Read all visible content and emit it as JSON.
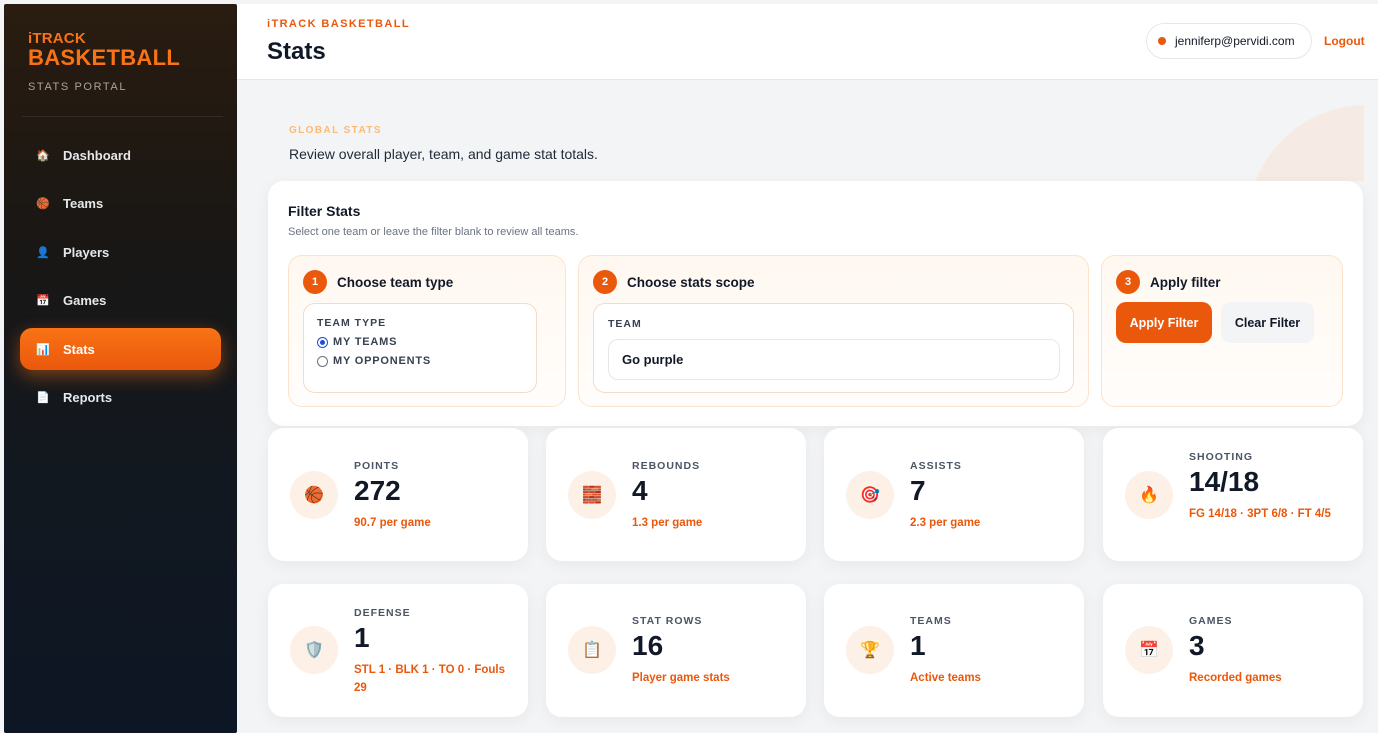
{
  "brand": {
    "top": "iTRACK",
    "main": "BASKETBALL",
    "sub": "STATS PORTAL"
  },
  "sidebar": {
    "items": [
      {
        "label": "Dashboard",
        "icon": "house-icon",
        "glyph": "🏠",
        "active": false
      },
      {
        "label": "Teams",
        "icon": "basketball-icon",
        "glyph": "🏀",
        "active": false
      },
      {
        "label": "Players",
        "icon": "person-icon",
        "glyph": "👤",
        "active": false
      },
      {
        "label": "Games",
        "icon": "calendar-icon",
        "glyph": "📅",
        "active": false
      },
      {
        "label": "Stats",
        "icon": "bar-chart-icon",
        "glyph": "📊",
        "active": true
      },
      {
        "label": "Reports",
        "icon": "document-icon",
        "glyph": "📄",
        "active": false
      }
    ]
  },
  "header": {
    "kicker": "iTRACK BASKETBALL",
    "title": "Stats",
    "user_email": "jenniferp@pervidi.com",
    "logout": "Logout"
  },
  "intro": {
    "kicker": "GLOBAL STATS",
    "description": "Review overall player, team, and game stat totals."
  },
  "filter": {
    "title": "Filter Stats",
    "subtitle": "Select one team or leave the filter blank to review all teams.",
    "step1": {
      "num": "1",
      "title": "Choose team type",
      "label": "TEAM TYPE",
      "options": [
        {
          "label": "MY TEAMS",
          "checked": true
        },
        {
          "label": "MY OPPONENTS",
          "checked": false
        }
      ]
    },
    "step2": {
      "num": "2",
      "title": "Choose stats scope",
      "label": "TEAM",
      "value": "Go purple"
    },
    "step3": {
      "num": "3",
      "title": "Apply filter",
      "apply": "Apply Filter",
      "clear": "Clear Filter"
    }
  },
  "cards": [
    {
      "label": "POINTS",
      "value": "272",
      "sub": "90.7 per game",
      "icon": "basketball-icon",
      "glyph": "🏀"
    },
    {
      "label": "REBOUNDS",
      "value": "4",
      "sub": "1.3 per game",
      "icon": "brick-icon",
      "glyph": "🧱"
    },
    {
      "label": "ASSISTS",
      "value": "7",
      "sub": "2.3 per game",
      "icon": "target-icon",
      "glyph": "🎯"
    },
    {
      "label": "SHOOTING",
      "value": "14/18",
      "sub": "FG 14/18 · 3PT 6/8 · FT 4/5",
      "icon": "fire-icon",
      "glyph": "🔥"
    },
    {
      "label": "DEFENSE",
      "value": "1",
      "sub": "STL 1 · BLK 1 · TO 0 · Fouls 29",
      "icon": "shield-icon",
      "glyph": "🛡️"
    },
    {
      "label": "STAT ROWS",
      "value": "16",
      "sub": "Player game stats",
      "icon": "clipboard-icon",
      "glyph": "📋"
    },
    {
      "label": "TEAMS",
      "value": "1",
      "sub": "Active teams",
      "icon": "trophy-icon",
      "glyph": "🏆"
    },
    {
      "label": "GAMES",
      "value": "3",
      "sub": "Recorded games",
      "icon": "calendar-icon",
      "glyph": "📅"
    }
  ]
}
